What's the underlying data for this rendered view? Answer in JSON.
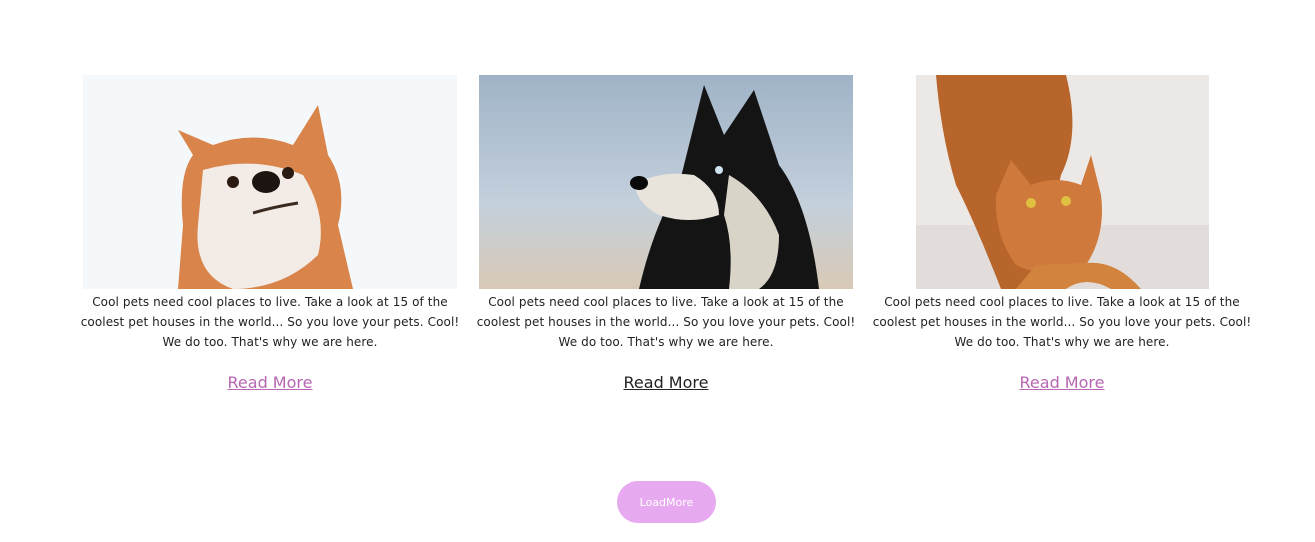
{
  "cards": [
    {
      "image": "akita-dog-photo",
      "text": "Cool pets need cool places to live. Take a look at 15 of the coolest pet houses in the world... So you love your pets. Cool! We do too. That's why we are here.",
      "link": "Read More"
    },
    {
      "image": "husky-dog-photo",
      "text": "Cool pets need cool places to live. Take a look at 15 of the coolest pet houses in the world... So you love your pets. Cool! We do too. That's why we are here.",
      "link": "Read More"
    },
    {
      "image": "orange-cat-photo",
      "text": "Cool pets need cool places to live. Take a look at 15 of the coolest pet houses in the world... So you love your pets. Cool! We do too. That's why we are here.",
      "link": "Read More"
    }
  ],
  "load_more_label": "LoadMore",
  "colors": {
    "link": "#b766b3",
    "link_hover": "#222222",
    "button_bg": "#e7a9ef",
    "button_text": "#ffffff"
  }
}
